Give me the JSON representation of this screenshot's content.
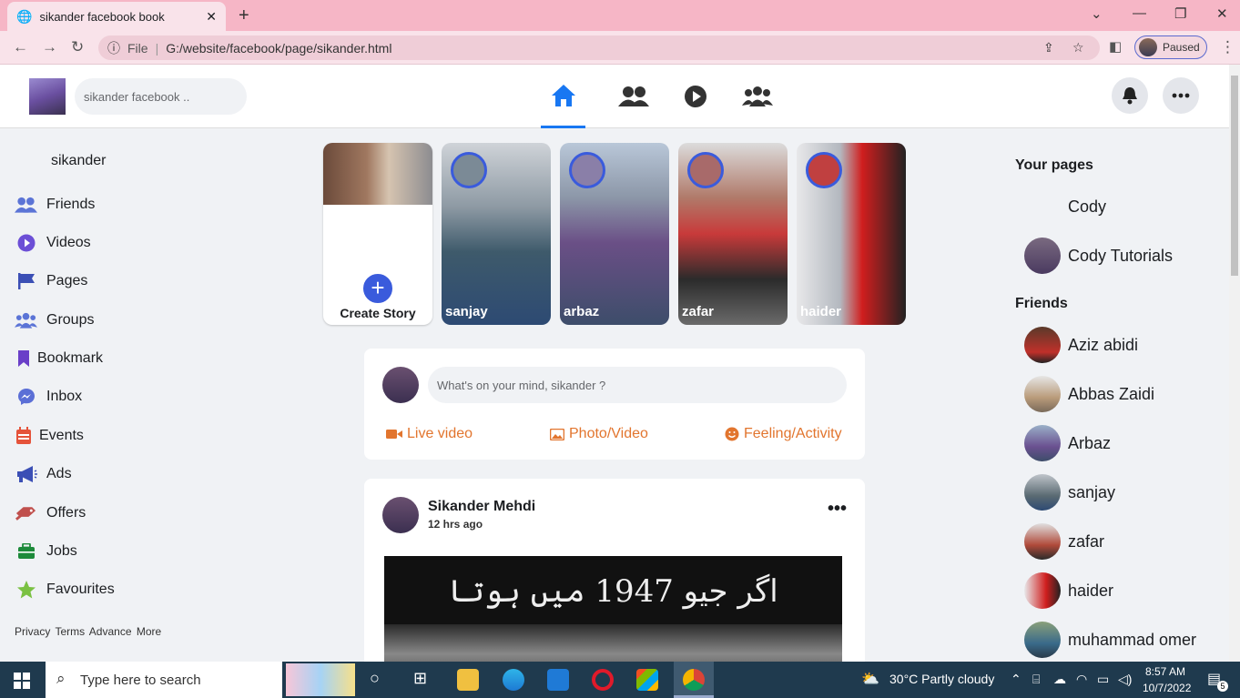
{
  "browser": {
    "tab_title": "sikander facebook book",
    "tab_close": "✕",
    "new_tab": "+",
    "address_label": "File",
    "address_sep": "|",
    "url": "G:/website/facebook/page/sikander.html",
    "profile_status": "Paused",
    "min_icon": "—",
    "max_icon": "❐",
    "close_icon": "✕",
    "chevron": "⌄"
  },
  "header": {
    "search_placeholder": "sikander facebook .."
  },
  "sidebar": {
    "username": "sikander",
    "items": [
      {
        "label": "Friends",
        "icon": "friends-icon",
        "color": "#5b74d6"
      },
      {
        "label": "Videos",
        "icon": "video-icon",
        "color": "#6c4fd6"
      },
      {
        "label": "Pages",
        "icon": "flag-icon",
        "color": "#3b4fb5"
      },
      {
        "label": "Groups",
        "icon": "groups-icon",
        "color": "#5b74d6"
      },
      {
        "label": "Bookmark",
        "icon": "bookmark-icon",
        "color": "#6a3fc8"
      },
      {
        "label": "Inbox",
        "icon": "messenger-icon",
        "color": "#5b6fd6"
      },
      {
        "label": "Events",
        "icon": "calendar-icon",
        "color": "#e5533a"
      },
      {
        "label": "Ads",
        "icon": "megaphone-icon",
        "color": "#3b4fb5"
      },
      {
        "label": "Offers",
        "icon": "offer-icon",
        "color": "#c0504d"
      },
      {
        "label": "Jobs",
        "icon": "briefcase-icon",
        "color": "#1d8a3a"
      },
      {
        "label": "Favourites",
        "icon": "star-icon",
        "color": "#7ac142"
      }
    ],
    "footer": "Privacy Terms Advance More"
  },
  "stories": {
    "create_label": "Create Story",
    "items": [
      {
        "name": "sanjay"
      },
      {
        "name": "arbaz"
      },
      {
        "name": "zafar"
      },
      {
        "name": "haider"
      }
    ]
  },
  "composer": {
    "placeholder": "What's on your mind, sikander ?",
    "live": "Live video",
    "photo": "Photo/Video",
    "feeling": "Feeling/Activity"
  },
  "post": {
    "author": "Sikander Mehdi",
    "time": "12 hrs ago",
    "menu": "•••",
    "image_text": "اگر جیو 1947 میں ہوتا"
  },
  "right": {
    "pages_heading": "Your pages",
    "pages": [
      "Cody",
      "Cody Tutorials"
    ],
    "friends_heading": "Friends",
    "friends": [
      "Aziz abidi",
      "Abbas Zaidi",
      "Arbaz",
      "sanjay",
      "zafar",
      "haider",
      "muhammad omer"
    ]
  },
  "taskbar": {
    "search_placeholder": "Type here to search",
    "weather": "30°C  Partly cloudy",
    "time": "8:57 AM",
    "date": "10/7/2022",
    "notifications": "5"
  },
  "colors": {
    "accent": "#1877f2",
    "composer_action": "#e2752e",
    "story_ring": "#3a5bdc"
  }
}
